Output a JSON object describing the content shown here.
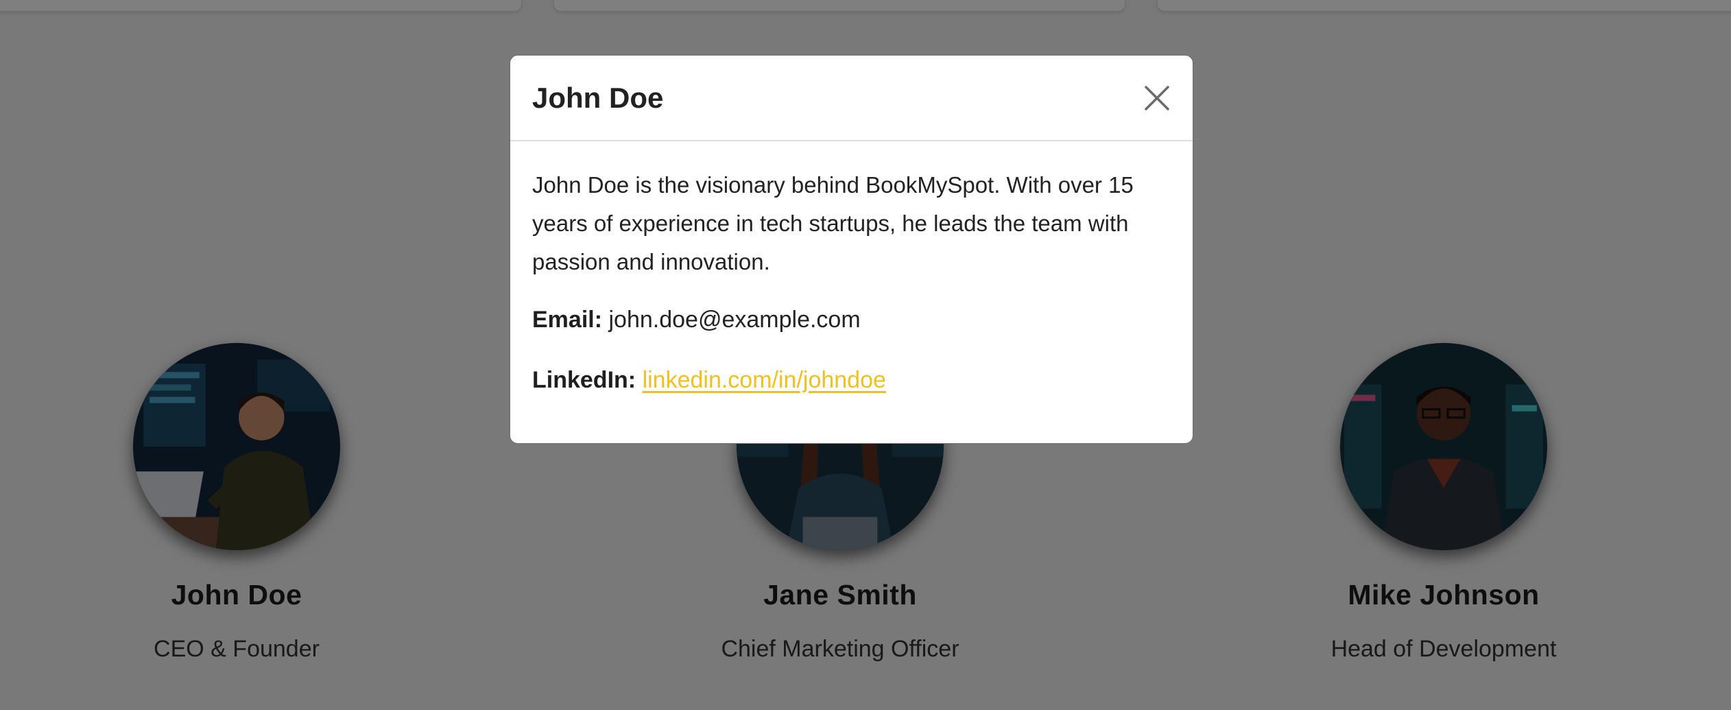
{
  "team": [
    {
      "name": "John Doe",
      "role": "CEO & Founder"
    },
    {
      "name": "Jane Smith",
      "role": "Chief Marketing Officer"
    },
    {
      "name": "Mike Johnson",
      "role": "Head of Development"
    }
  ],
  "modal": {
    "title": "John Doe",
    "bio": "John Doe is the visionary behind BookMySpot. With over 15 years of experience in tech startups, he leads the team with passion and innovation.",
    "email_label": "Email:",
    "email": "john.doe@example.com",
    "linkedin_label": "LinkedIn:",
    "linkedin": "linkedin.com/in/johndoe",
    "close_icon": "close-icon"
  },
  "colors": {
    "accent_link": "#f0c020",
    "overlay": "rgba(0,0,0,0.5)",
    "text": "#222222"
  }
}
